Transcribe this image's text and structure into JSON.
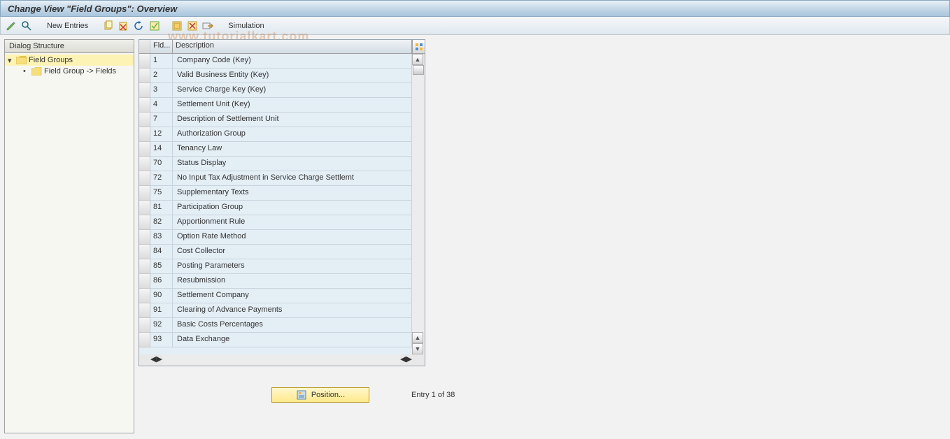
{
  "title": "Change View \"Field Groups\": Overview",
  "toolbar": {
    "new_entries": "New Entries",
    "simulation": "Simulation"
  },
  "tree": {
    "header": "Dialog Structure",
    "root": {
      "label": "Field Groups",
      "child": "Field Group -> Fields"
    }
  },
  "grid": {
    "headers": {
      "fld": "Fld...",
      "description": "Description"
    },
    "rows": [
      {
        "fld": "1",
        "desc": "Company Code (Key)"
      },
      {
        "fld": "2",
        "desc": "Valid Business Entity (Key)"
      },
      {
        "fld": "3",
        "desc": "Service Charge Key (Key)"
      },
      {
        "fld": "4",
        "desc": "Settlement Unit (Key)"
      },
      {
        "fld": "7",
        "desc": "Description of Settlement Unit"
      },
      {
        "fld": "12",
        "desc": "Authorization Group"
      },
      {
        "fld": "14",
        "desc": "Tenancy Law"
      },
      {
        "fld": "70",
        "desc": "Status Display"
      },
      {
        "fld": "72",
        "desc": "No Input Tax Adjustment in Service Charge Settlemt"
      },
      {
        "fld": "75",
        "desc": "Supplementary Texts"
      },
      {
        "fld": "81",
        "desc": "Participation Group"
      },
      {
        "fld": "82",
        "desc": "Apportionment Rule"
      },
      {
        "fld": "83",
        "desc": "Option Rate Method"
      },
      {
        "fld": "84",
        "desc": "Cost Collector"
      },
      {
        "fld": "85",
        "desc": "Posting Parameters"
      },
      {
        "fld": "86",
        "desc": "Resubmission"
      },
      {
        "fld": "90",
        "desc": "Settlement Company"
      },
      {
        "fld": "91",
        "desc": "Clearing of Advance Payments"
      },
      {
        "fld": "92",
        "desc": "Basic Costs Percentages"
      },
      {
        "fld": "93",
        "desc": "Data Exchange"
      }
    ]
  },
  "footer": {
    "position_label": "Position...",
    "entry_text": "Entry 1 of 38"
  },
  "watermark": "www.tutorialkart.com"
}
